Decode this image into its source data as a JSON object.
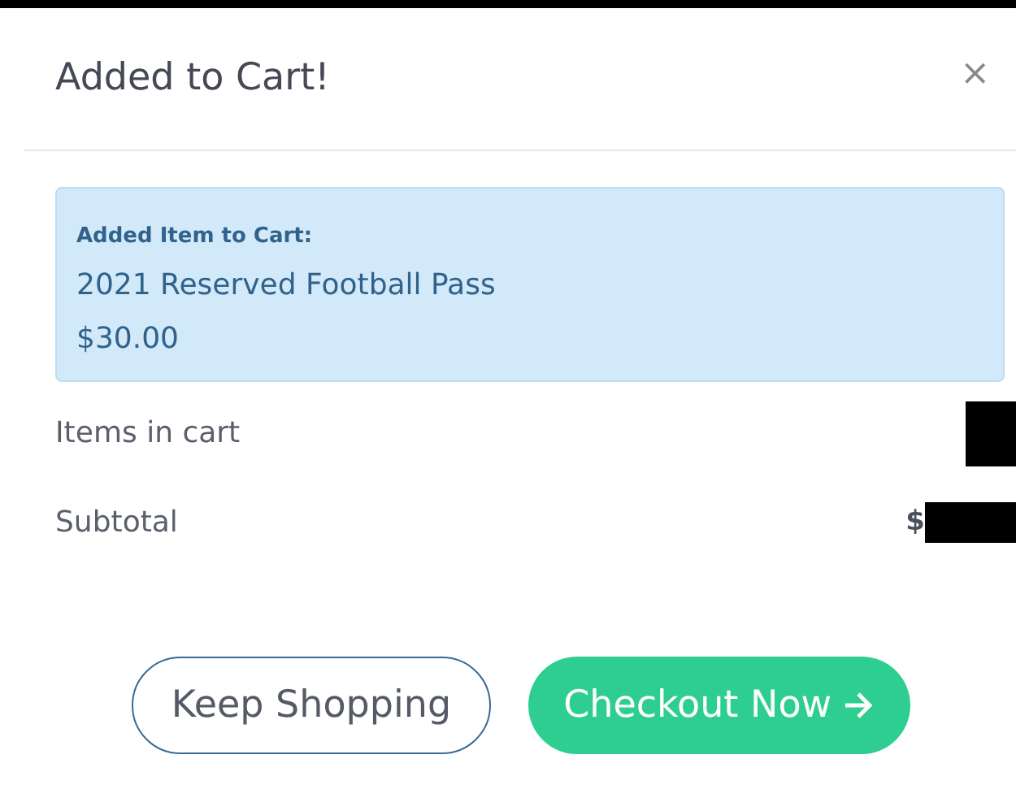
{
  "modal": {
    "title": "Added to Cart!",
    "close": "×"
  },
  "alert": {
    "heading": "Added Item to Cart:",
    "item": "2021 Reserved Football Pass",
    "price": "$30.00"
  },
  "summary": [
    {
      "label": "Items in cart",
      "redacted": true
    },
    {
      "label": "Subtotal",
      "value": "$",
      "redacted": true
    }
  ],
  "buttons": [
    {
      "label": "Keep Shopping",
      "kind": "outline"
    },
    {
      "label": "Checkout Now",
      "kind": "primary",
      "arrow": true
    }
  ]
}
